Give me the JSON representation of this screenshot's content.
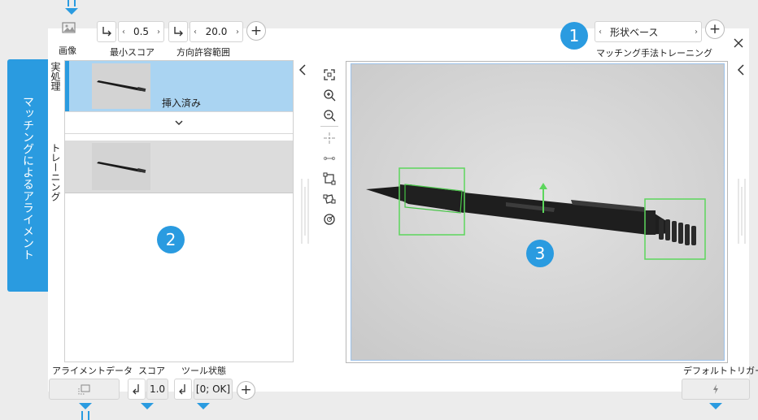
{
  "app": {
    "vertical_tab": "マッチングによるアライメント"
  },
  "toolbar": {
    "image_label": "画像",
    "min_score": {
      "label": "最小スコア",
      "value": "0.5"
    },
    "angle_tolerance": {
      "label": "方向許容範囲",
      "value": "20.0"
    },
    "matching_method": {
      "label": "マッチング手法トレーニング",
      "value": "形状ベース"
    },
    "badge1": "1"
  },
  "left_panel": {
    "section_run": "実処理",
    "section_train": "トレーニング",
    "inserted_label": "挿入済み",
    "badge2": "2"
  },
  "viewer": {
    "badge3": "3",
    "side_tools": [
      "fit-icon",
      "zoom-in-icon",
      "zoom-out-icon",
      "center-icon",
      "line-icon",
      "rect-icon",
      "rotated-rect-icon",
      "circle-target-icon"
    ]
  },
  "bottom": {
    "alignment_data_label": "アライメントデータ",
    "score_label": "スコア",
    "score_value": "1.0",
    "tool_state_label": "ツール状態",
    "tool_state_value": "[0; OK]",
    "default_trigger_label": "デフォルトトリガー"
  },
  "colors": {
    "accent": "#2a9be0",
    "selected_row": "#aad4f2",
    "match_box": "#5cd65c"
  }
}
